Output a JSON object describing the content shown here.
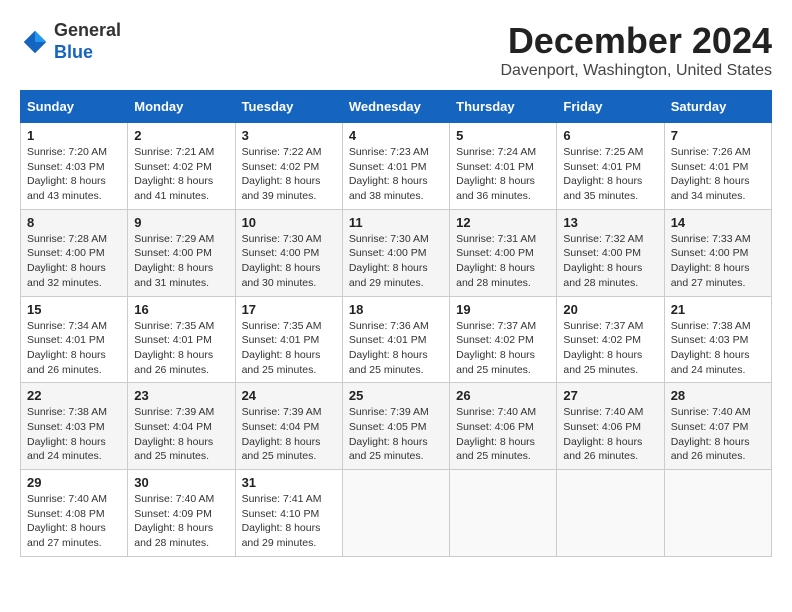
{
  "header": {
    "logo_general": "General",
    "logo_blue": "Blue",
    "month_title": "December 2024",
    "location": "Davenport, Washington, United States"
  },
  "weekdays": [
    "Sunday",
    "Monday",
    "Tuesday",
    "Wednesday",
    "Thursday",
    "Friday",
    "Saturday"
  ],
  "weeks": [
    [
      {
        "day": "1",
        "sunrise": "7:20 AM",
        "sunset": "4:03 PM",
        "daylight": "8 hours and 43 minutes."
      },
      {
        "day": "2",
        "sunrise": "7:21 AM",
        "sunset": "4:02 PM",
        "daylight": "8 hours and 41 minutes."
      },
      {
        "day": "3",
        "sunrise": "7:22 AM",
        "sunset": "4:02 PM",
        "daylight": "8 hours and 39 minutes."
      },
      {
        "day": "4",
        "sunrise": "7:23 AM",
        "sunset": "4:01 PM",
        "daylight": "8 hours and 38 minutes."
      },
      {
        "day": "5",
        "sunrise": "7:24 AM",
        "sunset": "4:01 PM",
        "daylight": "8 hours and 36 minutes."
      },
      {
        "day": "6",
        "sunrise": "7:25 AM",
        "sunset": "4:01 PM",
        "daylight": "8 hours and 35 minutes."
      },
      {
        "day": "7",
        "sunrise": "7:26 AM",
        "sunset": "4:01 PM",
        "daylight": "8 hours and 34 minutes."
      }
    ],
    [
      {
        "day": "8",
        "sunrise": "7:28 AM",
        "sunset": "4:00 PM",
        "daylight": "8 hours and 32 minutes."
      },
      {
        "day": "9",
        "sunrise": "7:29 AM",
        "sunset": "4:00 PM",
        "daylight": "8 hours and 31 minutes."
      },
      {
        "day": "10",
        "sunrise": "7:30 AM",
        "sunset": "4:00 PM",
        "daylight": "8 hours and 30 minutes."
      },
      {
        "day": "11",
        "sunrise": "7:30 AM",
        "sunset": "4:00 PM",
        "daylight": "8 hours and 29 minutes."
      },
      {
        "day": "12",
        "sunrise": "7:31 AM",
        "sunset": "4:00 PM",
        "daylight": "8 hours and 28 minutes."
      },
      {
        "day": "13",
        "sunrise": "7:32 AM",
        "sunset": "4:00 PM",
        "daylight": "8 hours and 28 minutes."
      },
      {
        "day": "14",
        "sunrise": "7:33 AM",
        "sunset": "4:00 PM",
        "daylight": "8 hours and 27 minutes."
      }
    ],
    [
      {
        "day": "15",
        "sunrise": "7:34 AM",
        "sunset": "4:01 PM",
        "daylight": "8 hours and 26 minutes."
      },
      {
        "day": "16",
        "sunrise": "7:35 AM",
        "sunset": "4:01 PM",
        "daylight": "8 hours and 26 minutes."
      },
      {
        "day": "17",
        "sunrise": "7:35 AM",
        "sunset": "4:01 PM",
        "daylight": "8 hours and 25 minutes."
      },
      {
        "day": "18",
        "sunrise": "7:36 AM",
        "sunset": "4:01 PM",
        "daylight": "8 hours and 25 minutes."
      },
      {
        "day": "19",
        "sunrise": "7:37 AM",
        "sunset": "4:02 PM",
        "daylight": "8 hours and 25 minutes."
      },
      {
        "day": "20",
        "sunrise": "7:37 AM",
        "sunset": "4:02 PM",
        "daylight": "8 hours and 25 minutes."
      },
      {
        "day": "21",
        "sunrise": "7:38 AM",
        "sunset": "4:03 PM",
        "daylight": "8 hours and 24 minutes."
      }
    ],
    [
      {
        "day": "22",
        "sunrise": "7:38 AM",
        "sunset": "4:03 PM",
        "daylight": "8 hours and 24 minutes."
      },
      {
        "day": "23",
        "sunrise": "7:39 AM",
        "sunset": "4:04 PM",
        "daylight": "8 hours and 25 minutes."
      },
      {
        "day": "24",
        "sunrise": "7:39 AM",
        "sunset": "4:04 PM",
        "daylight": "8 hours and 25 minutes."
      },
      {
        "day": "25",
        "sunrise": "7:39 AM",
        "sunset": "4:05 PM",
        "daylight": "8 hours and 25 minutes."
      },
      {
        "day": "26",
        "sunrise": "7:40 AM",
        "sunset": "4:06 PM",
        "daylight": "8 hours and 25 minutes."
      },
      {
        "day": "27",
        "sunrise": "7:40 AM",
        "sunset": "4:06 PM",
        "daylight": "8 hours and 26 minutes."
      },
      {
        "day": "28",
        "sunrise": "7:40 AM",
        "sunset": "4:07 PM",
        "daylight": "8 hours and 26 minutes."
      }
    ],
    [
      {
        "day": "29",
        "sunrise": "7:40 AM",
        "sunset": "4:08 PM",
        "daylight": "8 hours and 27 minutes."
      },
      {
        "day": "30",
        "sunrise": "7:40 AM",
        "sunset": "4:09 PM",
        "daylight": "8 hours and 28 minutes."
      },
      {
        "day": "31",
        "sunrise": "7:41 AM",
        "sunset": "4:10 PM",
        "daylight": "8 hours and 29 minutes."
      },
      null,
      null,
      null,
      null
    ]
  ]
}
